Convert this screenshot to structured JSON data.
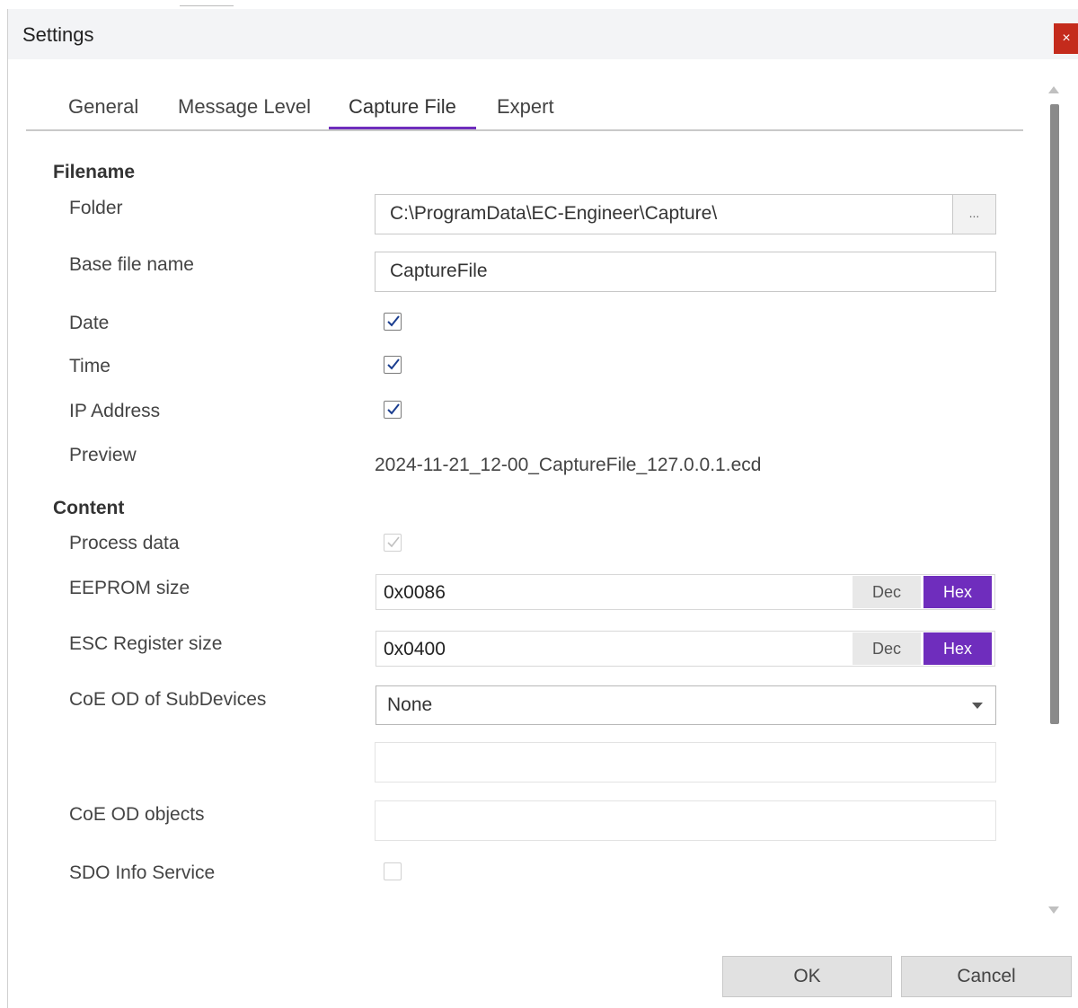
{
  "window": {
    "title": "Settings",
    "close_label": "×"
  },
  "tabs": [
    {
      "label": "General",
      "active": false
    },
    {
      "label": "Message Level",
      "active": false
    },
    {
      "label": "Capture File",
      "active": true
    },
    {
      "label": "Expert",
      "active": false
    }
  ],
  "filename": {
    "heading": "Filename",
    "folder": {
      "label": "Folder",
      "value": "C:\\ProgramData\\EC-Engineer\\Capture\\",
      "browse_label": "..."
    },
    "base_file_name": {
      "label": "Base file name",
      "value": "CaptureFile"
    },
    "date": {
      "label": "Date",
      "checked": true
    },
    "time": {
      "label": "Time",
      "checked": true
    },
    "ip_address": {
      "label": "IP Address",
      "checked": true
    },
    "preview": {
      "label": "Preview",
      "value": "2024-11-21_12-00_CaptureFile_127.0.0.1.ecd"
    }
  },
  "content": {
    "heading": "Content",
    "process_data": {
      "label": "Process data",
      "checked": true,
      "disabled": true
    },
    "eeprom_size": {
      "label": "EEPROM size",
      "value": "0x0086",
      "dec_label": "Dec",
      "hex_label": "Hex",
      "mode": "Hex"
    },
    "esc_register_size": {
      "label": "ESC Register size",
      "value": "0x0400",
      "dec_label": "Dec",
      "hex_label": "Hex",
      "mode": "Hex"
    },
    "coe_od_subdevices": {
      "label": "CoE OD of SubDevices",
      "selected": "None",
      "extra_value": ""
    },
    "coe_od_objects": {
      "label": "CoE OD objects",
      "value": ""
    },
    "sdo_info_service": {
      "label": "SDO Info Service",
      "checked": false,
      "disabled": true
    }
  },
  "buttons": {
    "ok": "OK",
    "cancel": "Cancel"
  },
  "colors": {
    "accent": "#6f2dbd",
    "close": "#c42b1c"
  }
}
